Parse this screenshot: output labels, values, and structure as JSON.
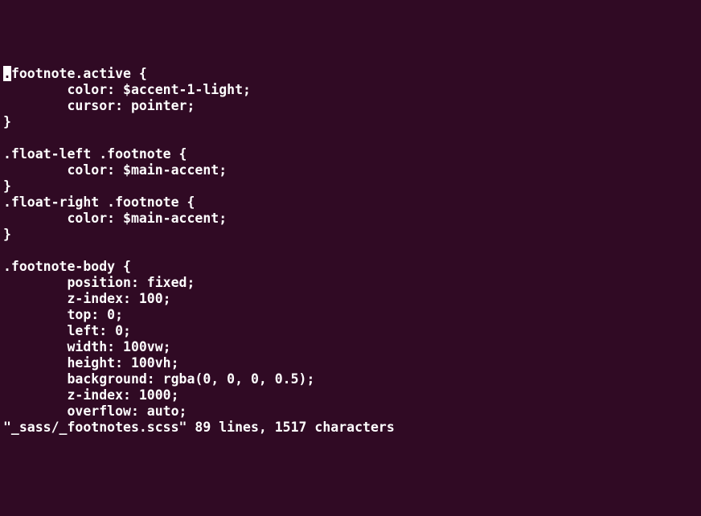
{
  "editor": {
    "cursor_char": ".",
    "lines": [
      "footnote.active {",
      "        color: $accent-1-light;",
      "        cursor: pointer;",
      "}",
      "",
      ".float-left .footnote {",
      "        color: $main-accent;",
      "}",
      ".float-right .footnote {",
      "        color: $main-accent;",
      "}",
      "",
      ".footnote-body {",
      "        position: fixed;",
      "        z-index: 100;",
      "        top: 0;",
      "        left: 0;",
      "        width: 100vw;",
      "        height: 100vh;",
      "        background: rgba(0, 0, 0, 0.5);",
      "        z-index: 1000;",
      "        overflow: auto;"
    ],
    "status_line": "\"_sass/_footnotes.scss\" 89 lines, 1517 characters"
  }
}
